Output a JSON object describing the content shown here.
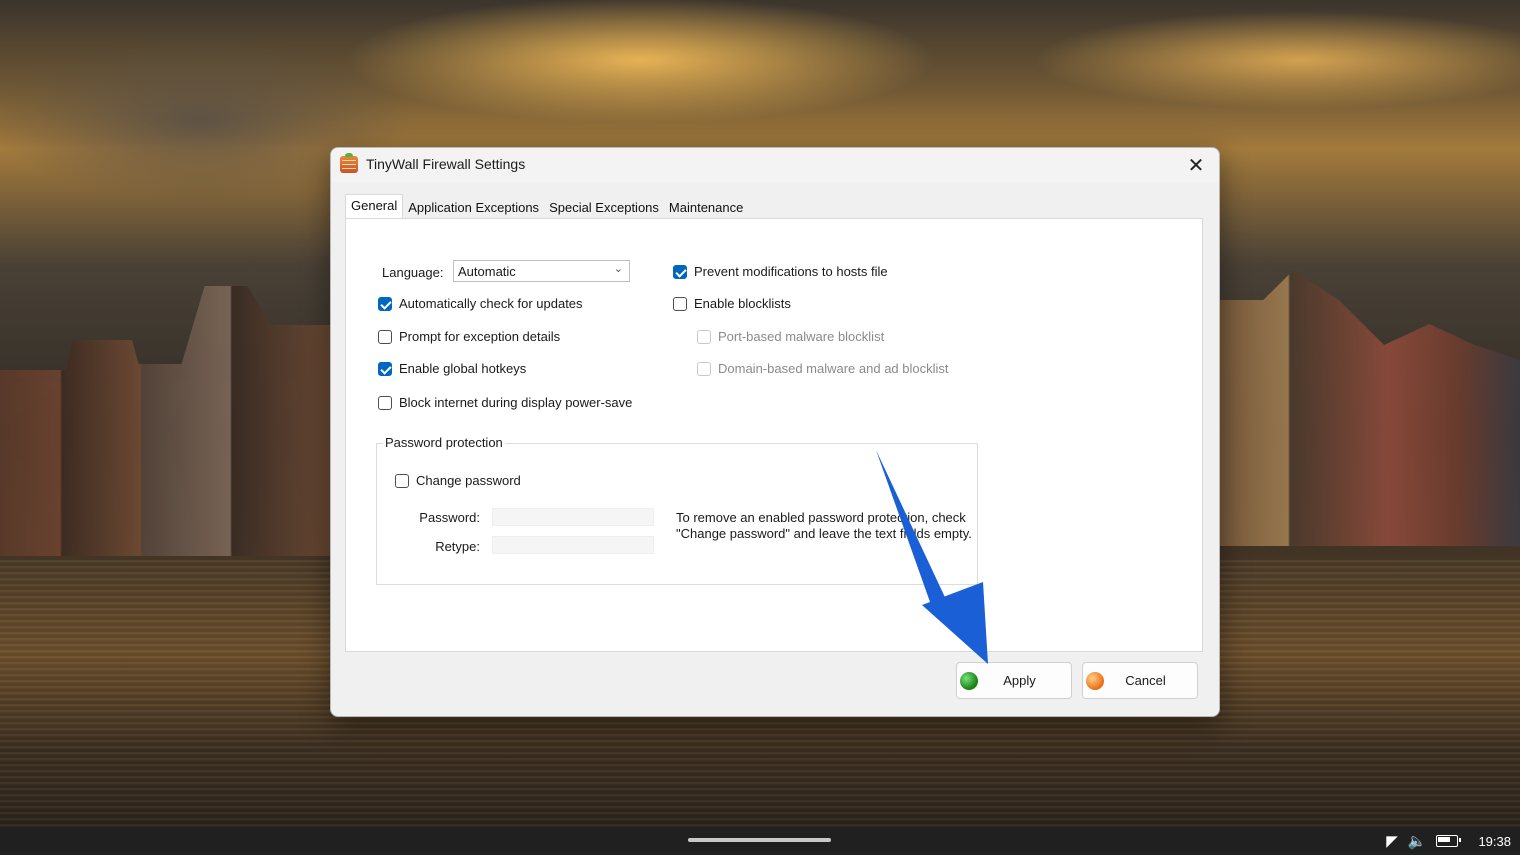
{
  "window": {
    "title": "TinyWall Firewall Settings",
    "close_symbol": "✕"
  },
  "tabs": [
    {
      "label": "General",
      "active": true
    },
    {
      "label": "Application Exceptions",
      "active": false
    },
    {
      "label": "Special Exceptions",
      "active": false
    },
    {
      "label": "Maintenance",
      "active": false
    }
  ],
  "general": {
    "language_label": "Language:",
    "language_value": "Automatic",
    "auto_update": {
      "label": "Automatically check for updates",
      "checked": true
    },
    "prompt_exception": {
      "label": "Prompt for exception details",
      "checked": false
    },
    "global_hotkeys": {
      "label": "Enable global hotkeys",
      "checked": true
    },
    "block_powersave": {
      "label": "Block internet during display power-save",
      "checked": false
    },
    "prevent_hosts": {
      "label": "Prevent modifications to hosts file",
      "checked": true
    },
    "enable_blocklists": {
      "label": "Enable blocklists",
      "checked": false
    },
    "port_blocklist": {
      "label": "Port-based malware blocklist",
      "checked": false,
      "disabled": true
    },
    "domain_blocklist": {
      "label": "Domain-based malware and ad blocklist",
      "checked": false,
      "disabled": true
    }
  },
  "password_group": {
    "title": "Password protection",
    "change_password": {
      "label": "Change password",
      "checked": false
    },
    "password_label": "Password:",
    "password_value": "",
    "retype_label": "Retype:",
    "retype_value": "",
    "note_line1": "To remove an enabled password protection, check",
    "note_line2": "\"Change password\" and leave the text fields empty."
  },
  "buttons": {
    "apply": "Apply",
    "cancel": "Cancel"
  },
  "colors": {
    "accent": "#0067c0",
    "annotation_arrow": "#1a5fd6"
  },
  "taskbar": {
    "wifi_icon": "wifi-icon",
    "volume_icon": "volume-icon",
    "battery_icon": "battery-icon",
    "time": "19:38"
  }
}
